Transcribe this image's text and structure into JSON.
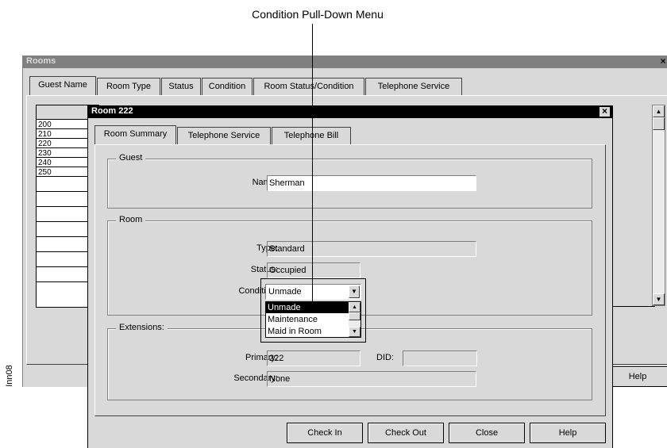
{
  "callout": {
    "label": "Condition Pull-Down Menu"
  },
  "side_label": "Inn08",
  "rooms_window": {
    "title": "Rooms",
    "close_glyph": "×",
    "tabs": [
      "Guest Name",
      "Room Type",
      "Status",
      "Condition",
      "Room Status/Condition",
      "Telephone Service"
    ],
    "rows": [
      "200",
      "210",
      "220",
      "230",
      "240",
      "250",
      "",
      "",
      "",
      "",
      "",
      ""
    ],
    "help_label": "Help"
  },
  "dialog": {
    "title": "Room 222",
    "close_glyph": "×",
    "tabs": [
      "Room Summary",
      "Telephone Service",
      "Telephone Bill"
    ],
    "guest": {
      "group_label": "Guest",
      "name_label": "Name:",
      "name_value": "Sherman"
    },
    "room": {
      "group_label": "Room",
      "type_label": "Type:",
      "type_value": "Standard",
      "status_label": "Status:",
      "status_value": "Occupied",
      "condition_label": "Condition:",
      "condition_value": "Unmade",
      "condition_options": [
        "Unmade",
        "Maintenance",
        "Maid in Room"
      ]
    },
    "extensions": {
      "group_label": "Extensions:",
      "primary_label": "Primary:",
      "primary_value": "222",
      "did_label": "DID:",
      "did_value": "",
      "secondary_label": "Secondary:",
      "secondary_value": "None"
    },
    "buttons": {
      "check_in": "Check In",
      "check_out": "Check Out",
      "close": "Close",
      "help": "Help"
    }
  },
  "colors": {
    "window_bg": "#d9d9d9",
    "titlebar": "#000000",
    "selection": "#000000"
  }
}
